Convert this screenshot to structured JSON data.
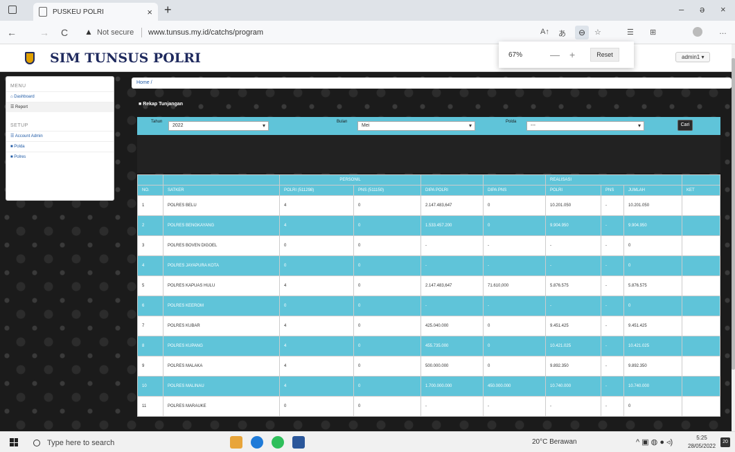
{
  "browser": {
    "tab_title": "PUSKEU POLRI",
    "tab_close": "×",
    "new_tab": "+",
    "not_secure": "Not secure",
    "url": "www.tunsus.my.id/catchs/program",
    "back": "←",
    "forward": "→",
    "reload": "C",
    "warn_icon": "▲",
    "zoom_popup": {
      "percent": "67%",
      "minus": "—",
      "plus": "+",
      "reset": "Reset"
    },
    "win_min": "–",
    "win_restore": "ə",
    "win_close": "×"
  },
  "app": {
    "brand": "SIM TUNSUS POLRI",
    "user": "admin1 ▾"
  },
  "sidebar": {
    "menu_header": "MENU",
    "items": [
      {
        "label": "Dashboard"
      },
      {
        "label": "Report"
      }
    ],
    "setup_header": "SETUP",
    "setup_items": [
      {
        "label": "Account Admin"
      },
      {
        "label": "Polda"
      },
      {
        "label": "Polres"
      }
    ]
  },
  "breadcrumb": "Home /",
  "panel_title": "Rekap Tunjangan",
  "filter": {
    "tahun_label": "Tahun",
    "tahun_value": "2022",
    "bulan_label": "Bulan",
    "bulan_value": "Mei",
    "polda_label": "Polda",
    "polda_value": "---",
    "cari_label": "Cari"
  },
  "table": {
    "group_headers": {
      "personil": "PERSONIL",
      "realisasi": "REALISASI"
    },
    "headers": [
      "NO.",
      "SATKER",
      "POLRI (511298)",
      "PNS (511150)",
      "DIPA POLRI",
      "DIPA PNS",
      "POLRI",
      "PNS",
      "JUMLAH",
      "KET"
    ],
    "rows": [
      [
        "1",
        "POLRES BELU",
        "4",
        "0",
        "2.147.483,647",
        "0",
        "10.201.050",
        "-",
        "10.201.050",
        ""
      ],
      [
        "2",
        "POLRES BENGKAYANG",
        "4",
        "0",
        "1.533.457.200",
        "0",
        "9.904.950",
        "-",
        "9.904.950",
        ""
      ],
      [
        "3",
        "POLRES BOVEN DIGOEL",
        "0",
        "0",
        "-",
        "-",
        "-",
        "-",
        "0",
        ""
      ],
      [
        "4",
        "POLRES JAYAPURA KOTA",
        "0",
        "0",
        "-",
        "-",
        "-",
        "-",
        "0",
        ""
      ],
      [
        "5",
        "POLRES KAPUAS HULU",
        "4",
        "0",
        "2.147.483,647",
        "71.610,000",
        "5.876.575",
        "-",
        "5.876.575",
        ""
      ],
      [
        "6",
        "POLRES KEEROM",
        "0",
        "0",
        "-",
        "-",
        "-",
        "-",
        "0",
        ""
      ],
      [
        "7",
        "POLRES KUBAR",
        "4",
        "0",
        "425.040.000",
        "0",
        "9.451.425",
        "-",
        "9.451.425",
        ""
      ],
      [
        "8",
        "POLRES KUPANG",
        "4",
        "0",
        "455.735.000",
        "0",
        "10.421.025",
        "-",
        "10.421.025",
        ""
      ],
      [
        "9",
        "POLRES MALAKA",
        "4",
        "0",
        "500.000.000",
        "0",
        "9.892.350",
        "-",
        "9.892.350",
        ""
      ],
      [
        "10",
        "POLRES MALINAU",
        "4",
        "0",
        "1.700.000.000",
        "450.000.000",
        "10.740.000",
        "-",
        "10.740.000",
        ""
      ],
      [
        "11",
        "POLRES MARAUKE",
        "0",
        "0",
        "-",
        "-",
        "-",
        "-",
        "0",
        ""
      ]
    ]
  },
  "taskbar": {
    "search_placeholder": "Type here to search",
    "weather": "20°C Berawan",
    "tray_icons": "^ ▣ ◍ ● ◃)",
    "time": "5:25",
    "date": "28/05/2022",
    "notifications": "20"
  },
  "colors": {
    "table_accent": "#5fc4d9",
    "brand": "#1f2a5e"
  }
}
